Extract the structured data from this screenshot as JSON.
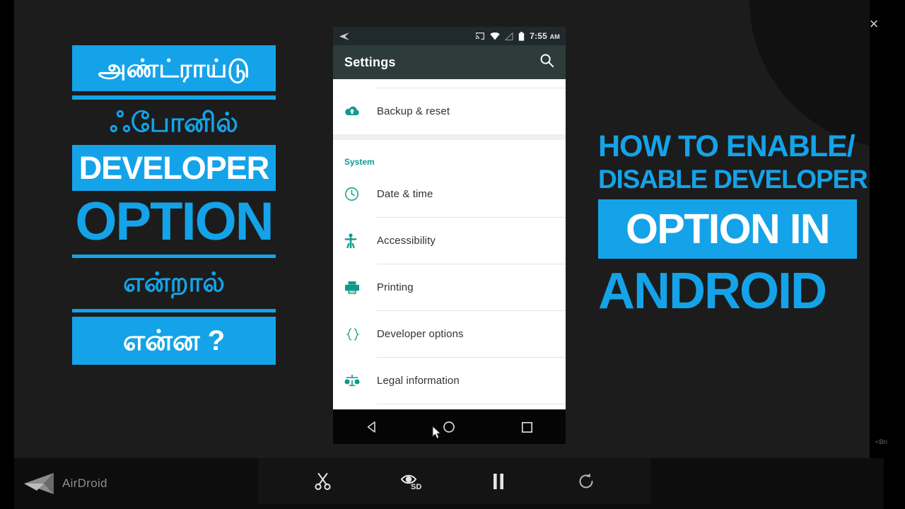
{
  "window": {
    "close_label": "×",
    "edge_label": "<Bri",
    "accent_blue": "#14A3E8",
    "accent_teal": "#11998e",
    "background": "#1c1c1c"
  },
  "left_title": {
    "line1": "அண்ட்ராய்டு",
    "line2": "ஃபோனில்",
    "line3": "DEVELOPER",
    "line4": "OPTION",
    "line5": "என்றால்",
    "line6": "என்ன ?"
  },
  "right_title": {
    "line1": "HOW TO ENABLE/",
    "line2": "DISABLE DEVELOPER",
    "line3": "OPTION IN",
    "line4": "ANDROID"
  },
  "phone": {
    "statusbar": {
      "time": "7:55",
      "ampm": "AM",
      "icons": [
        "airdroid-arrow-icon",
        "cast-icon",
        "wifi-icon",
        "signal-icon",
        "battery-icon"
      ]
    },
    "appbar": {
      "title": "Settings",
      "search_icon": "search-icon"
    },
    "sections": [
      {
        "header": null,
        "items": [
          {
            "label": "Backup & reset",
            "icon": "cloud-upload-icon"
          }
        ]
      },
      {
        "header": "System",
        "items": [
          {
            "label": "Date & time",
            "icon": "clock-icon"
          },
          {
            "label": "Accessibility",
            "icon": "accessibility-icon"
          },
          {
            "label": "Printing",
            "icon": "printer-icon"
          },
          {
            "label": "Developer options",
            "icon": "braces-icon"
          },
          {
            "label": "Legal information",
            "icon": "scales-icon"
          }
        ]
      }
    ],
    "navbar": {
      "back": "back-triangle-icon",
      "home": "home-circle-icon",
      "recents": "recents-square-icon"
    }
  },
  "bottom_toolbar": {
    "brand": "AirDroid",
    "buttons": [
      {
        "name": "screenshot-scissors-button",
        "icon": "scissors-icon"
      },
      {
        "name": "quality-sd-button",
        "icon": "eye-sd-icon",
        "label": "SD"
      },
      {
        "name": "pause-button",
        "icon": "pause-icon"
      },
      {
        "name": "rotate-refresh-button",
        "icon": "refresh-icon"
      }
    ]
  }
}
